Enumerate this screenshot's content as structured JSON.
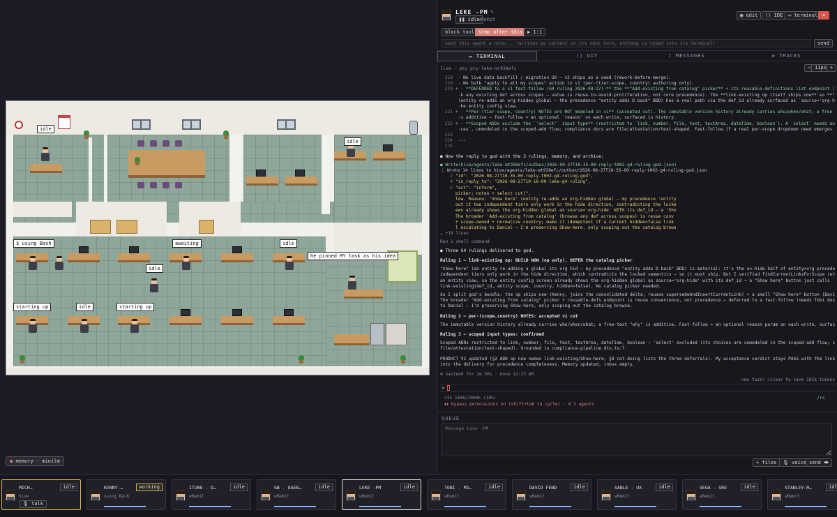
{
  "office": {
    "bubbles": [
      "idle",
      "idle",
      "$ using Bash",
      "awaiting",
      "idle",
      "he pinned MY task as his idea",
      "idle",
      "starting up",
      "idle",
      "starting up"
    ]
  },
  "memory_chip": "memory · minilm",
  "agent_header": {
    "name": "LEKE -PM",
    "status": "idle",
    "subtitle": "wRemit",
    "edit": "edit",
    "ide": "IDE",
    "terminal": "terminal",
    "close": "×"
  },
  "controls": {
    "block_tools": "block tools",
    "stop_after": "stop after this step",
    "step": "▶ 1:1",
    "note_placeholder": "send this agent a note... (arrives as context on its next turn, nothing is typed into its terminal)",
    "send": "send"
  },
  "tabs": [
    "TERMINAL",
    "GIT",
    "MESSAGES",
    "TRACES"
  ],
  "live_bar": {
    "label": "live · pty pty-leke-mt938efc",
    "minus": "−",
    "size": "11px",
    "plus": "+"
  },
  "terminal": {
    "diff": [
      {
        "n": "218",
        "t": " - No live data backfill / migration UX — v2 ships as a seed (rework-before-merge)."
      },
      {
        "n": "219",
        "t": " - No bulk \"apply to all my scopes\" action in v1 (per-(tier-scope, country) authoring only)."
      },
      {
        "n": "220",
        "t": "+ - **DEFERRED to a v1 fast-follow (G4 ruling 2026-08-27):** the **\"Add-existing from catalog\" picker** + its reusable-definitions list endpoint (browse & lin"
      },
      {
        "n": "",
        "t": "  -k any existing def across scopes — value is reuse-to-avoid-proliferation, not core precedence). The **link-existing op itself ships now** so **\"Show here\"**"
      },
      {
        "n": "",
        "t": "  (entity re-adds an org-hidden global — the precedence \"entity adds D back\" BDD) has a real path via the def_id already surfaced as `source='org-hide'` in t"
      },
      {
        "n": "",
        "t": "  -he entity config view."
      },
      {
        "n": "221",
        "t": "+ - **Per-(tier-scope, country) NOTES are NOT modeled in v1** (accepted cut). The immutable version history already carries who/when/what; a free-text \"why\" i"
      },
      {
        "n": "",
        "t": "  -s additive — fast-follow = an optional `reason` on each write, surfaced in history."
      },
      {
        "n": "222",
        "t": "+ - **Scoped ADDs exclude the `'select'` input type** (restricted to `link, number, file, text, textArea, dateTime, boolean`). A `select` needs authored `choi"
      },
      {
        "n": "",
        "t": "  -ces`, unmodeled in the scoped-add flow; compliance docs are file/attestation/text-shaped. Fast-follow if a real per-scope dropdown need emerges."
      },
      {
        "n": "223",
        "t": ""
      },
      {
        "n": "224",
        "t": " ---"
      },
      {
        "n": "225",
        "t": ""
      }
    ],
    "intro": "● Now the reply to god with the 3 rulings, memory, and archive:",
    "write_call": "● Write(hive/agents/leke-mt938efc/outbox/2026-08-27T10-35-00-reply-t002-g4-ruling-god.json)",
    "write_result": "  ⎿ Wrote 14 lines to hive/agents/leke-mt938efc/outbox/2026-08-27T10-35-00-reply-t002-g4-ruling-god.json",
    "json_lines": [
      {
        "n": "2",
        "t": "\"id\": \"2026-08-27T10-35-00-reply-t002-g4-ruling-god\","
      },
      {
        "n": "4",
        "t": "\"in_reply_to\": \"2026-08-27T10-16-00-leke-g4-ruling\","
      },
      {
        "n": "5",
        "t": "\"act\": \"inform\","
      },
      {
        "n": "",
        "t": "picker; notes + select cut)\","
      },
      {
        "n": "",
        "t": "low. Reason: 'Show here' (entity re-adds an org-hidden global — my precedence 'entity"
      },
      {
        "n": "",
        "t": "out it two independent tiers only work in the hide direction, contradicting the locke"
      },
      {
        "n": "",
        "t": "een already shows the org-hidden global as source='org-hide' WITH its def_id — a 'Sho"
      },
      {
        "n": "",
        "t": "The broader 'Add-existing from catalog' (browse any def across scopes) is reuse conv"
      },
      {
        "n": "",
        "t": "+ scope-owned + normalize country; make it idempotent if a current hidden=false link"
      },
      {
        "n": "",
        "t": "l escalating to Daniel — I'm preserving Show-here, only scoping out the catalog brows"
      }
    ],
    "more_lines": "… +18 lines",
    "ran": "Ran 1 shell command",
    "delivered": "● Three G4 rulings delivered to god.",
    "ruling1_title": "Ruling 1 — link-existing op: BUILD NOW (op only), DEFER the catalog picker",
    "ruling1_p1": [
      "\"Show here\" (an entity re-adding a global its org hid — my precedence \"entity adds D back\" BDD) is material: it's the un-hide half of entity>org precedence. Without it, two",
      "independent tiers only work in the hide direction, which contradicts the locked semantics — so it must ship. But I verified findCurrentLinksForScope returns both tiers for",
      "an entity view, so the entity config screen already shows the org-hidden global as source='org-hide' with its def_id → a \"Show here\" button just calls",
      "link-existing(def_id, entity scope, country, hidden=false). No catalog picker needed."
    ],
    "ruling1_p2": [
      "So I split god's bundle: the op ships now (Kenny, joins the consolidated delta; reuses supersedeAndInsertCurrentLink) + a small \"Show here\" button (David, no new design).",
      "The broader \"Add-existing from catalog\" picker + reusable-defs endpoint is reuse convenience, not precedence → deferred to a fast-follow (needs Tobi design). Not escalating",
      "to Daniel — I'm preserving Show-here, only scoping out the catalog browse."
    ],
    "ruling2_title": "Ruling 2 — per-(scope,country) NOTES: accepted v1 cut",
    "ruling2_p": "The immutable version history already carries who/when/what; a free-text \"why\" is additive. Fast-follow = an optional reason param on each write, surfaced in history.",
    "ruling3_title": "Ruling 3 — scoped input types: confirmed",
    "ruling3_p": [
      "Scoped ADDs restricted to link, number, file, text, textArea, dateTime, boolean — 'select' excluded (its choices are unmodeled in the scoped-add flow; compliance docs are",
      "file/attestation/text-shaped). Grounded in compliance-pipeline.dto.ts:7."
    ],
    "product_p": [
      "PRODUCT_V2 updated (§2 ADD op now names link-existing/Show-here; §8 not-doing lists the three deferrals). My acceptance verdict stays PASS with the link-existing op folded",
      "into the delivery for precedence completeness. Memory updated, inbox empty."
    ],
    "sauteed": "✻ Sautéed for 2m 50s · done 12:23 AM",
    "new_task_hint": "new task? /clear to save 185k tokens"
  },
  "prompt": "> ",
  "ctx": {
    "line1": "ctx 184k/1000k (18%)",
    "rc": "/rc",
    "line2": "⏵⏵ bypass permissions on (shift+tab to cycle) · 4 3 agents"
  },
  "queue": {
    "label": "QUEUE",
    "placeholder": "Message Leke -PM",
    "files": "+ files",
    "voice": "🎙 voice",
    "send": "send ⮕"
  },
  "agents": [
    {
      "name": "MICH…",
      "status": "idle",
      "sub": "hive",
      "talk": "🎙 talk"
    },
    {
      "name": "KENNY-…",
      "status": "working",
      "sub": "using Bash"
    },
    {
      "name": "ITUNU - D…",
      "status": "idle",
      "sub": "wRemit"
    },
    {
      "name": "GB - OAEN…",
      "status": "idle",
      "sub": "wRemit"
    },
    {
      "name": "LEKE -PM",
      "status": "idle",
      "sub": "wRemit"
    },
    {
      "name": "TOBI - PD…",
      "status": "idle",
      "sub": "wRemit"
    },
    {
      "name": "DAVID FEND",
      "status": "idle",
      "sub": "wRemit"
    },
    {
      "name": "SABLE - UX",
      "status": "idle",
      "sub": "wRemit"
    },
    {
      "name": "VEGA - SRE",
      "status": "idle",
      "sub": "wRemit"
    },
    {
      "name": "STANLEY-M…",
      "status": "idle",
      "sub": "wRemit"
    }
  ]
}
